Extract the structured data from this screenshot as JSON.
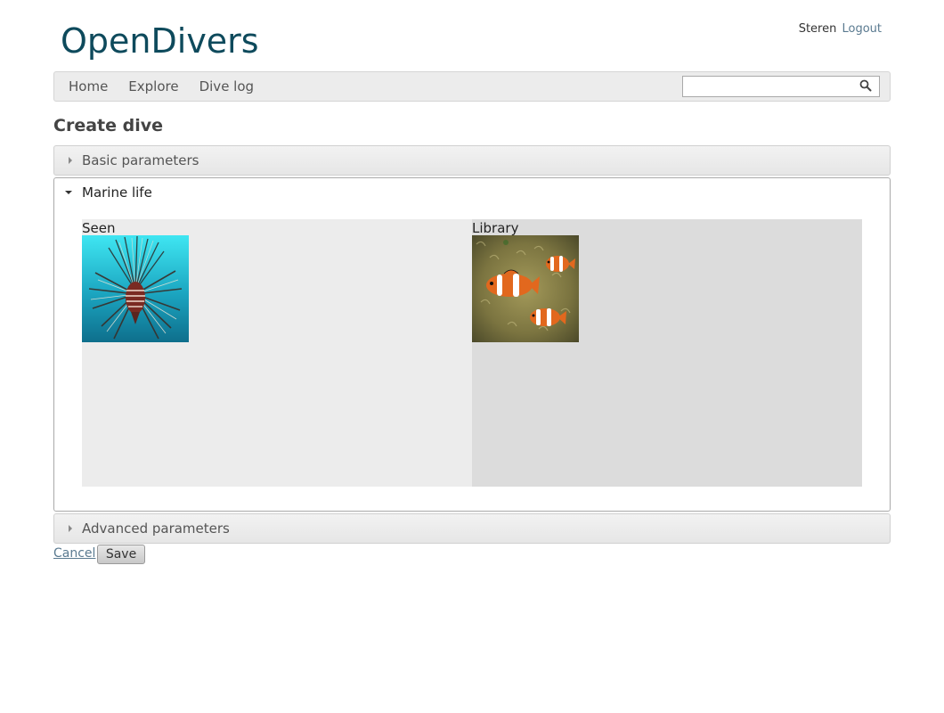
{
  "header": {
    "logo_text": "OpenDivers",
    "username": "Steren",
    "logout_label": "Logout"
  },
  "nav": {
    "items": [
      {
        "label": "Home"
      },
      {
        "label": "Explore"
      },
      {
        "label": "Dive log"
      }
    ],
    "search_placeholder": ""
  },
  "page": {
    "title": "Create dive"
  },
  "sections": {
    "basic": {
      "label": "Basic parameters",
      "state": "collapsed"
    },
    "marine": {
      "label": "Marine life",
      "state": "expanded",
      "seen_label": "Seen",
      "library_label": "Library",
      "seen_items": [
        {
          "name": "lionfish"
        }
      ],
      "library_items": [
        {
          "name": "clownfish"
        }
      ]
    },
    "advanced": {
      "label": "Advanced parameters",
      "state": "collapsed"
    }
  },
  "actions": {
    "cancel_label": "Cancel",
    "save_label": "Save"
  },
  "colors": {
    "brand": "#0e4a5c",
    "link": "#5a7a90",
    "seen_pane": "#ececec",
    "library_pane": "#dcdcdc"
  }
}
